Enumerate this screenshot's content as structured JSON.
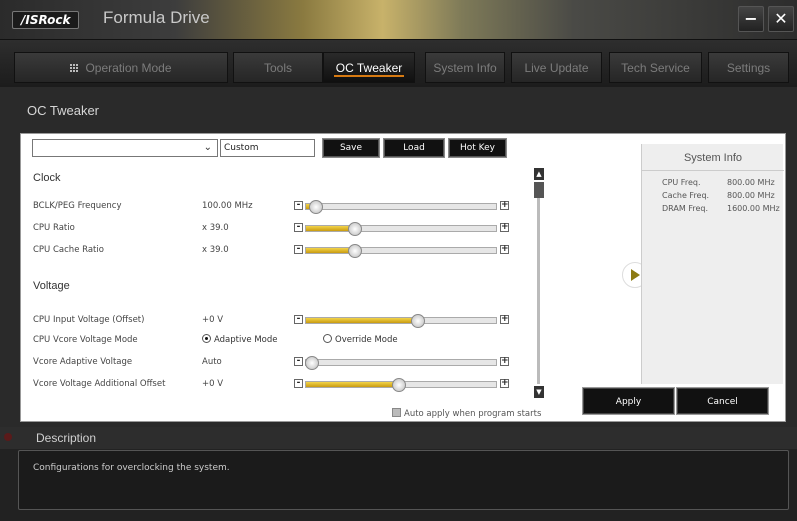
{
  "window": {
    "brand": "/ISRock",
    "title": "Formula Drive",
    "minimize_label": "−",
    "close_label": "✕"
  },
  "nav": {
    "tabs": [
      {
        "label": "Operation Mode",
        "icon": "grid-icon"
      },
      {
        "label": "Tools"
      },
      {
        "label": "OC Tweaker",
        "active": true
      },
      {
        "label": "System Info"
      },
      {
        "label": "Live Update"
      },
      {
        "label": "Tech Service"
      },
      {
        "label": "Settings"
      }
    ]
  },
  "section": {
    "title": "OC Tweaker"
  },
  "profile": {
    "selected": "",
    "name_value": "Custom",
    "save_label": "Save Profile",
    "load_label": "Load Profile",
    "hotkey_label": "Hot Key"
  },
  "groups": {
    "clock": "Clock",
    "voltage": "Voltage"
  },
  "rows": {
    "bclk": {
      "label": "BCLK/PEG Frequency",
      "value": "100.00 MHz",
      "level": 0.05
    },
    "cpu_ratio": {
      "label": "CPU Ratio",
      "value": "x 39.0",
      "level": 0.26
    },
    "cache_ratio": {
      "label": "CPU Cache Ratio",
      "value": "x 39.0",
      "level": 0.26
    },
    "input_v": {
      "label": "CPU Input Voltage (Offset)",
      "value": "+0 V",
      "level": 0.59
    },
    "vcore_mode": {
      "label": "CPU Vcore Voltage Mode",
      "adaptive_label": "Adaptive Mode",
      "override_label": "Override Mode",
      "selected": "Adaptive Mode"
    },
    "vcore_adaptive": {
      "label": "Vcore Adaptive Voltage",
      "value": "Auto",
      "level": 0.03
    },
    "vcore_offset": {
      "label": "Vcore Voltage Additional Offset",
      "value": "+0 V",
      "level": 0.49
    }
  },
  "auto_apply": {
    "label": "Auto apply when program starts",
    "checked": false
  },
  "system_info": {
    "title": "System Info",
    "items": [
      {
        "label": "CPU Freq.",
        "value": "800.00 MHz"
      },
      {
        "label": "Cache Freq.",
        "value": "800.00 MHz"
      },
      {
        "label": "DRAM Freq.",
        "value": "1600.00 MHz"
      }
    ]
  },
  "actions": {
    "apply_label": "Apply",
    "cancel_label": "Cancel"
  },
  "description": {
    "title": "Description",
    "text": "Configurations for overclocking the system."
  },
  "colors": {
    "accent": "#d77a12",
    "slider_fill": "#e0b52a"
  }
}
